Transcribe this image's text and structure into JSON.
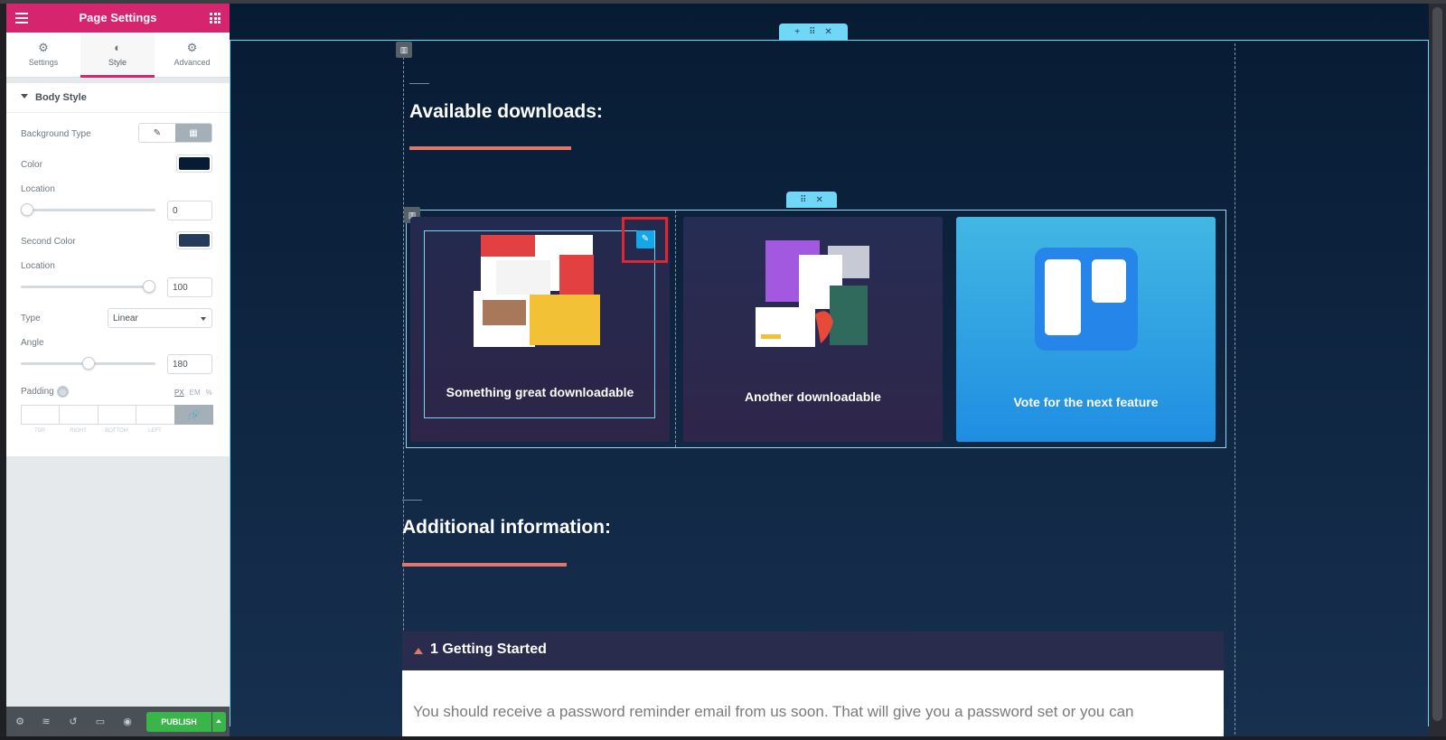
{
  "panel": {
    "title": "Page Settings",
    "tabs": [
      {
        "label": "Settings",
        "icon": "gear-icon"
      },
      {
        "label": "Style",
        "icon": "half-circle-icon"
      },
      {
        "label": "Advanced",
        "icon": "gear-icon"
      }
    ],
    "active_tab": "Style",
    "section_title": "Body Style",
    "background_type_label": "Background Type",
    "color_label": "Color",
    "color_value": "#071b33",
    "location1_label": "Location",
    "location1_value": "0",
    "location1_fraction": 0.0,
    "second_color_label": "Second Color",
    "second_color_value": "#253b5a",
    "location2_label": "Location",
    "location2_value": "100",
    "location2_fraction": 1.0,
    "type_label": "Type",
    "type_value": "Linear",
    "angle_label": "Angle",
    "angle_value": "180",
    "angle_fraction": 0.5,
    "padding_label": "Padding",
    "units": [
      "PX",
      "EM",
      "%"
    ],
    "padding_fields": [
      "TOP",
      "RIGHT",
      "BOTTOM",
      "LEFT"
    ],
    "publish_label": "PUBLISH"
  },
  "preview": {
    "heading1": "Available downloads:",
    "cards": [
      {
        "title": "Something great downloadable"
      },
      {
        "title": "Another downloadable"
      },
      {
        "title": "Vote for the next feature"
      }
    ],
    "heading2": "Additional information:",
    "accordion_title": "1 Getting Started",
    "accordion_text": "You should receive a password reminder email from us soon. That will give you a password set or you can"
  },
  "colors": {
    "brand": "#d6246e",
    "accent_outline": "#71d7f7",
    "heading_underline": "#e2766a",
    "publish": "#39b54a",
    "highlight": "#e0262e"
  }
}
